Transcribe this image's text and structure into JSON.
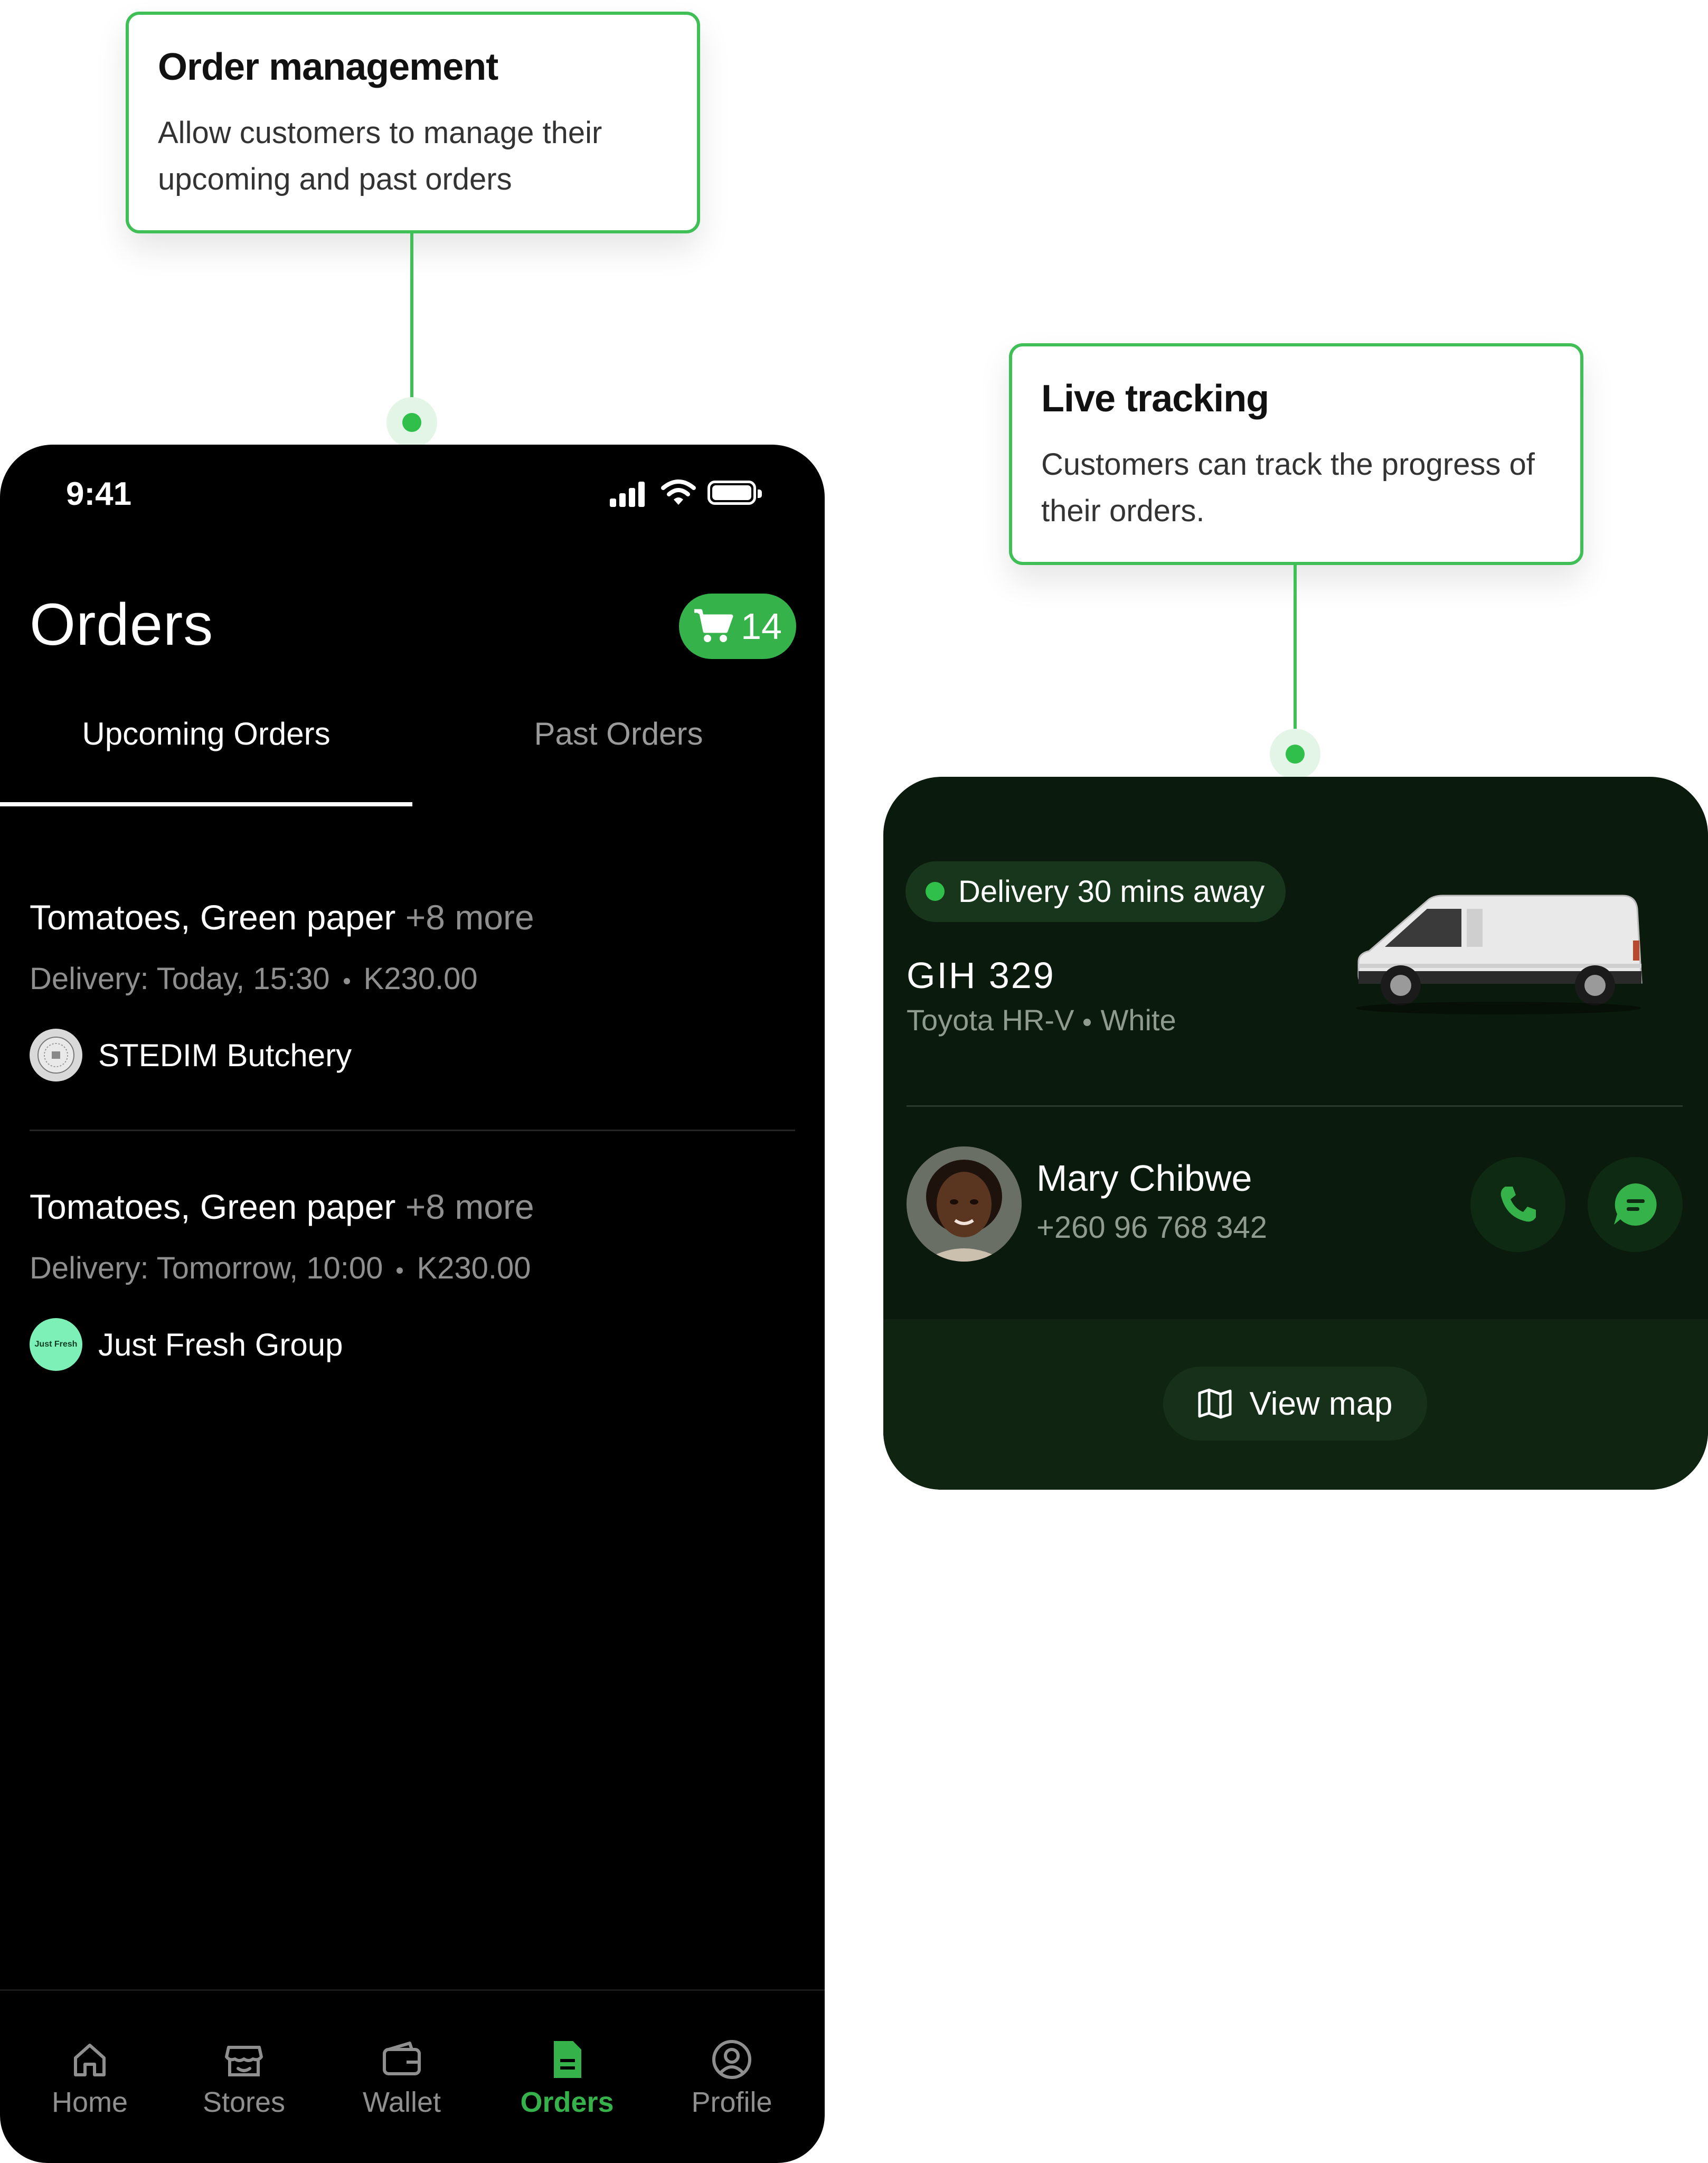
{
  "callouts": {
    "order_management": {
      "title": "Order management",
      "body": "Allow customers to manage their upcoming and past orders"
    },
    "live_tracking": {
      "title": "Live tracking",
      "body": "Customers can track the progress of their orders."
    }
  },
  "status_bar": {
    "time": "9:41"
  },
  "header": {
    "title": "Orders",
    "cart_count": "14"
  },
  "tabs": {
    "upcoming": "Upcoming Orders",
    "past": "Past Orders"
  },
  "orders": [
    {
      "items": "Tomatoes, Green paper",
      "more": "+8 more",
      "delivery": "Delivery: Today, 15:30",
      "amount": "K230.00",
      "store": "STEDIM Butchery"
    },
    {
      "items": "Tomatoes, Green paper",
      "more": "+8 more",
      "delivery": "Delivery: Tomorrow, 10:00",
      "amount": "K230.00",
      "store": "Just Fresh Group",
      "store_logo_text": "Just Fresh"
    }
  ],
  "bottom_nav": {
    "home": "Home",
    "stores": "Stores",
    "wallet": "Wallet",
    "orders": "Orders",
    "profile": "Profile"
  },
  "tracking": {
    "eta": "Delivery 30 mins away",
    "plate": "GIH  329",
    "car_model": "Toyota HR-V",
    "car_color": "White",
    "driver_name": "Mary Chibwe",
    "driver_phone": "+260 96 768 342",
    "view_map": "View map"
  },
  "colors": {
    "accent": "#36b24a",
    "callout_border": "#3fbf55",
    "track_bg": "#0a1a0c"
  }
}
